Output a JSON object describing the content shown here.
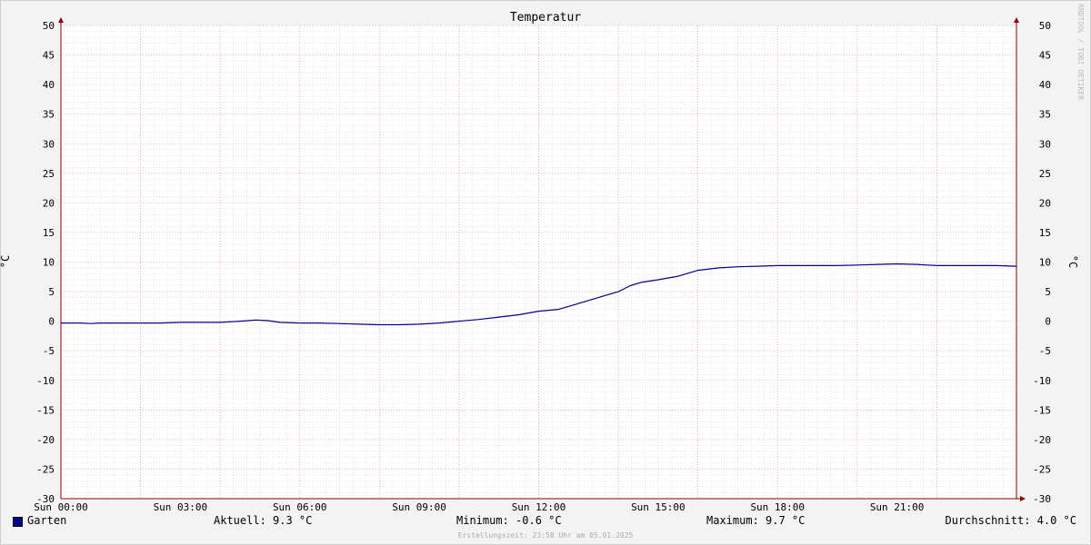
{
  "chart_data": {
    "type": "line",
    "title": "Temperatur",
    "ylabel": "°C",
    "ylim": [
      -30,
      50
    ],
    "yticks": [
      50,
      45,
      40,
      35,
      30,
      25,
      20,
      15,
      10,
      5,
      0,
      -5,
      -10,
      -15,
      -20,
      -25,
      -30
    ],
    "xlim_hours": [
      0,
      24
    ],
    "xtick_labels": [
      "Sun 00:00",
      "Sun 03:00",
      "Sun 06:00",
      "Sun 09:00",
      "Sun 12:00",
      "Sun 15:00",
      "Sun 18:00",
      "Sun 21:00"
    ],
    "grid": true,
    "series": [
      {
        "name": "Garten",
        "color": "#00008b",
        "x_hours": [
          0,
          0.5,
          0.75,
          1,
          1.5,
          2,
          2.5,
          3,
          3.5,
          4,
          4.5,
          4.9,
          5.2,
          5.5,
          6,
          6.5,
          7,
          7.5,
          8,
          8.5,
          9,
          9.5,
          10,
          10.5,
          11,
          11.5,
          12,
          12.5,
          13,
          13.5,
          14,
          14.3,
          14.6,
          15,
          15.5,
          16,
          16.5,
          17,
          17.5,
          18,
          18.5,
          19,
          19.5,
          20,
          20.5,
          21,
          21.5,
          22,
          22.5,
          23,
          23.5,
          24
        ],
        "values": [
          -0.3,
          -0.3,
          -0.4,
          -0.3,
          -0.3,
          -0.3,
          -0.3,
          -0.2,
          -0.2,
          -0.2,
          0,
          0.2,
          0.1,
          -0.2,
          -0.3,
          -0.3,
          -0.4,
          -0.5,
          -0.6,
          -0.6,
          -0.5,
          -0.3,
          0,
          0.3,
          0.7,
          1.1,
          1.7,
          2,
          3,
          4,
          5,
          6,
          6.6,
          7,
          7.6,
          8.6,
          9,
          9.2,
          9.3,
          9.4,
          9.4,
          9.4,
          9.4,
          9.5,
          9.6,
          9.7,
          9.6,
          9.4,
          9.4,
          9.4,
          9.4,
          9.3
        ]
      }
    ]
  },
  "legend": {
    "series_name": "Garten",
    "current": "Aktuell: 9.3 °C",
    "minimum": "Minimum: -0.6 °C",
    "maximum": "Maximum: 9.7 °C",
    "average": "Durchschnitt: 4.0 °C"
  },
  "footer": "Erstellungszeit: 23:58 Uhr am 05.01.2025",
  "watermark": "RRDTOOL / TOBI OETIKER",
  "colors": {
    "line": "#00008b",
    "major_grid": "#f08080",
    "minor_grid": "#cccccc",
    "axis": "#8b0000",
    "plot_bg": "#ffffff",
    "canvas_bg": "#f3f3f3"
  }
}
